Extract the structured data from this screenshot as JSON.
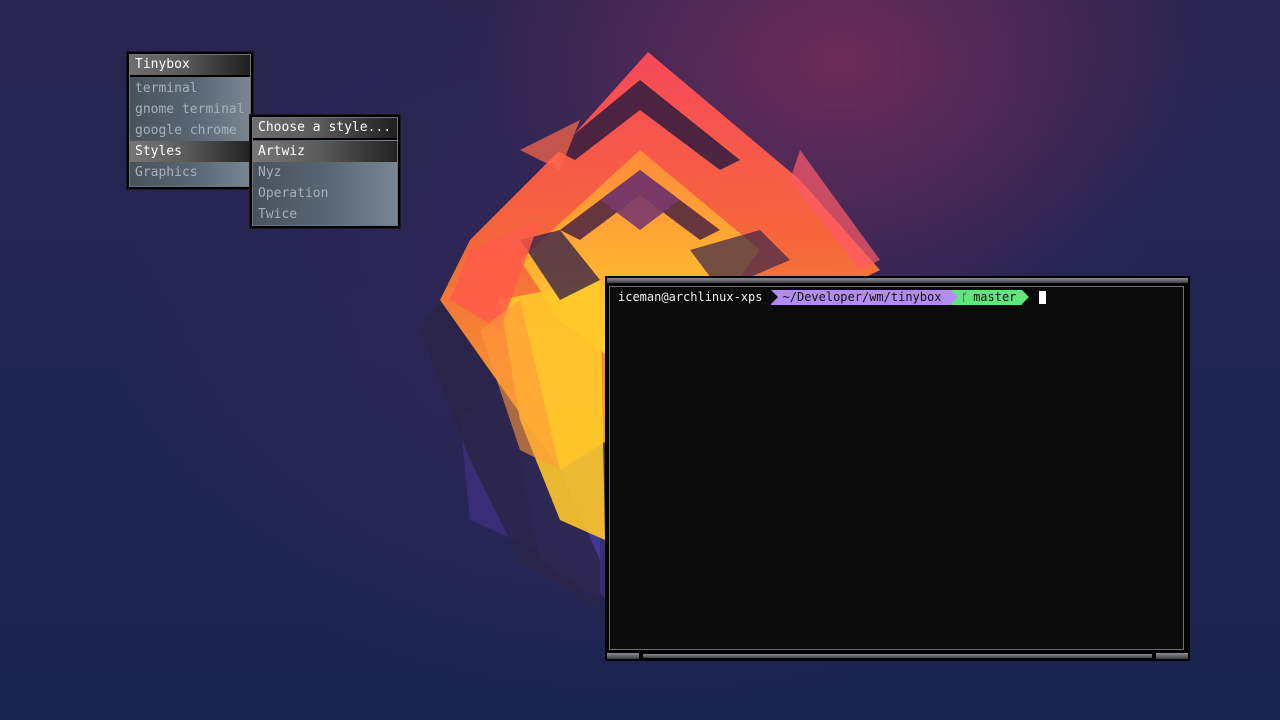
{
  "menu": {
    "title": "Tinybox",
    "items": [
      {
        "label": "terminal"
      },
      {
        "label": "gnome terminal"
      },
      {
        "label": "google chrome"
      },
      {
        "label": "Styles"
      },
      {
        "label": "Graphics"
      }
    ],
    "active_item": "Styles"
  },
  "styles_menu": {
    "title": "Choose a style...",
    "items": [
      {
        "label": "Artwiz"
      },
      {
        "label": "Nyz"
      },
      {
        "label": "Operation"
      },
      {
        "label": "Twice"
      }
    ],
    "active_item": "Artwiz"
  },
  "terminal": {
    "prompt_user": "iceman@archlinux-xps",
    "prompt_path": "~/Developer/wm/tinybox",
    "prompt_branch": "master",
    "branch_icon": "git-branch-icon",
    "colors": {
      "path_segment": "#b28cf3",
      "git_segment": "#5fe77c",
      "background": "#0c0c0c"
    }
  }
}
